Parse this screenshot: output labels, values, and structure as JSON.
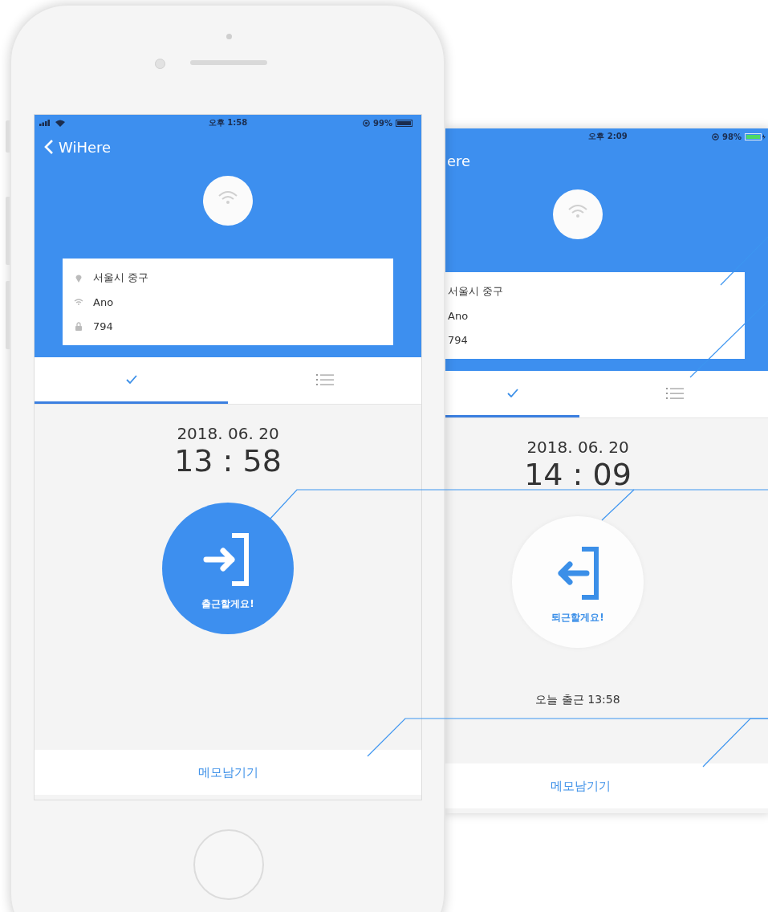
{
  "screens": [
    {
      "status_bar": {
        "signal": true,
        "time": "오후 1:58",
        "battery": "99%",
        "charging": false
      },
      "back_title": "WiHere",
      "info_rows": [
        {
          "kind": "location",
          "text": "서울시 중구"
        },
        {
          "kind": "wifi",
          "text": "Ano"
        },
        {
          "kind": "lock",
          "text": "794"
        }
      ],
      "tabs": [
        {
          "kind": "check",
          "selected": true
        },
        {
          "kind": "list",
          "selected": false
        }
      ],
      "date": "2018. 06. 20",
      "time": "13 : 58",
      "action": {
        "kind": "check_in",
        "label": "출근할게요!"
      },
      "memo_button": "메모남기기"
    },
    {
      "status_bar": {
        "time": "오후 2:09",
        "battery": "98%",
        "charging": true
      },
      "back_title": "ere",
      "info_rows": [
        {
          "kind": "plain",
          "text": "서울시 중구"
        },
        {
          "kind": "plain",
          "text": "Ano"
        },
        {
          "kind": "plain",
          "text": "794"
        }
      ],
      "tabs": [
        {
          "kind": "check",
          "selected": true
        },
        {
          "kind": "list",
          "selected": false
        }
      ],
      "date": "2018. 06. 20",
      "time": "14 : 09",
      "action": {
        "kind": "check_out",
        "label": "퇴근할게요!"
      },
      "note": "오늘 출근 13:58",
      "memo_button": "메모남기기"
    }
  ]
}
